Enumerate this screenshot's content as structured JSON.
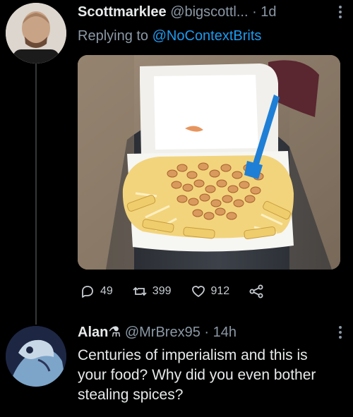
{
  "tweet": {
    "display_name": "Scottmarklee",
    "handle": "@bigscottl...",
    "time": "· 1d",
    "replying_prefix": "Replying to",
    "replying_to": "@NoContextBrits",
    "stats": {
      "replies": "49",
      "retweets": "399",
      "likes": "912"
    }
  },
  "reply": {
    "display_name": "Alan",
    "name_emoji": "⚗",
    "handle": "@MrBrex95",
    "time": "· 14h",
    "text": "Centuries of imperialism and this is your food? Why did you even bother stealing spices?"
  },
  "icons": {
    "reply": "comment-icon",
    "retweet": "retweet-icon",
    "like": "heart-icon",
    "share": "share-icon",
    "more": "more-icon"
  },
  "colors": {
    "background": "#000000",
    "text": "#e7e9ea",
    "muted": "#8b98a5",
    "link": "#1d9bf0",
    "fork": "#1f7fd6"
  }
}
